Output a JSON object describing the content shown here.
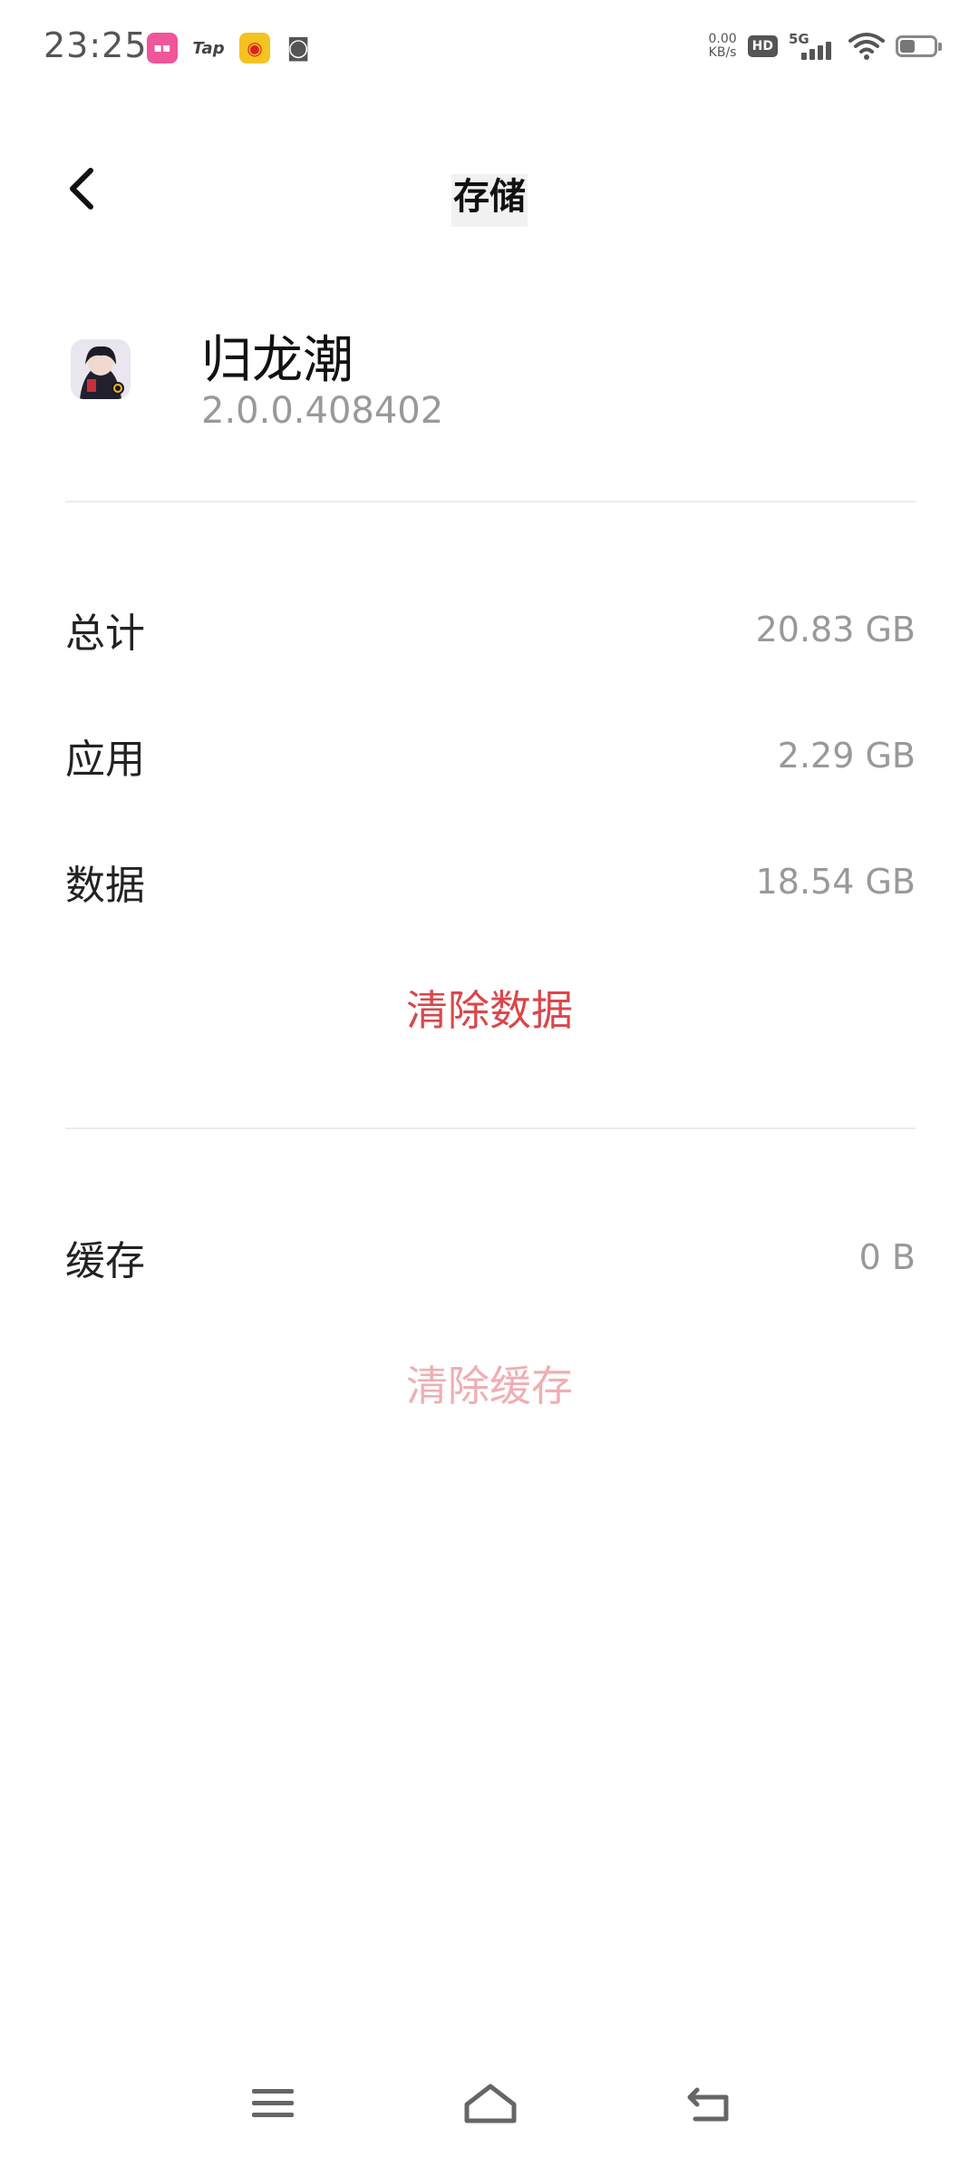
{
  "status_bar": {
    "time": "23:25",
    "app_icons": [
      "bilibili-icon",
      "taptap-icon",
      "weibo-icon",
      "cat-icon"
    ],
    "tap_label": "Tap",
    "net_speed_value": "0.00",
    "net_speed_unit": "KB/s",
    "hd_label": "HD",
    "network_label": "5G",
    "battery_level": 0.45
  },
  "header": {
    "title": "存储"
  },
  "app": {
    "name": "归龙潮",
    "version": "2.0.0.408402"
  },
  "storage": {
    "total_label": "总计",
    "total_value": "20.83 GB",
    "app_label": "应用",
    "app_value": "2.29 GB",
    "data_label": "数据",
    "data_value": "18.54 GB",
    "clear_data_label": "清除数据"
  },
  "cache": {
    "label": "缓存",
    "value": "0 B",
    "clear_cache_label": "清除缓存"
  },
  "colors": {
    "danger": "#d9474c",
    "danger_disabled": "#f0aeb2"
  }
}
